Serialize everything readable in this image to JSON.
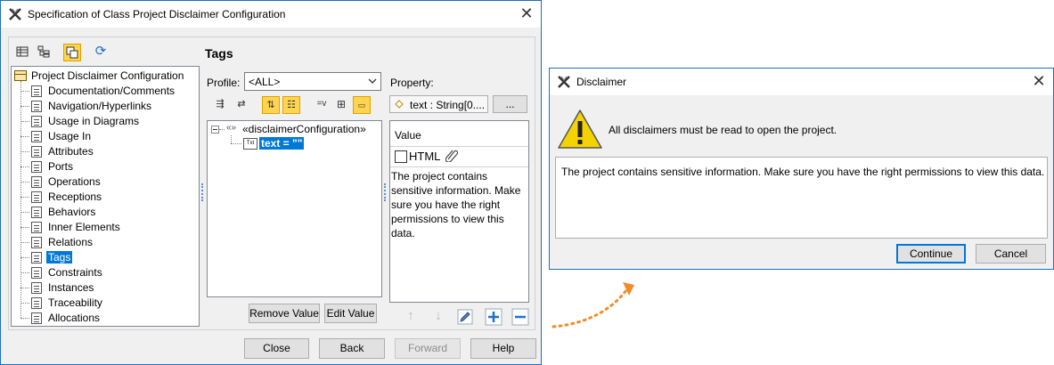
{
  "spec": {
    "title": "Specification of Class Project Disclaimer Configuration",
    "tree": {
      "root": "Project Disclaimer Configuration",
      "items": [
        "Documentation/Comments",
        "Navigation/Hyperlinks",
        "Usage in Diagrams",
        "Usage In",
        "Attributes",
        "Ports",
        "Operations",
        "Receptions",
        "Behaviors",
        "Inner Elements",
        "Relations",
        "Tags",
        "Constraints",
        "Instances",
        "Traceability",
        "Allocations"
      ],
      "selected_index": 11
    },
    "panel_title": "Tags",
    "profile_label": "Profile:",
    "profile_value": "<ALL>",
    "property_label": "Property:",
    "property_value": "text : String[0....",
    "property_button": "...",
    "tag_tree": {
      "stereotype": "«disclaimerConfiguration»",
      "stereotype_prefix": "«»",
      "tag_value": "text = \"\"",
      "text_icon": "Txt"
    },
    "value_header": "Value",
    "html_label": "HTML",
    "value_text": "The project contains sensitive information. Make sure you have the right permissions to view this data.",
    "remove_value": "Remove Value",
    "edit_value": "Edit Value",
    "toolbar_extra": "=v",
    "buttons": {
      "close": "Close",
      "back": "Back",
      "forward": "Forward",
      "help": "Help"
    }
  },
  "disclaimer": {
    "title": "Disclaimer",
    "message": "All disclaimers must be read to open the project.",
    "content": "The project contains sensitive information. Make sure you have the right permissions to view this data.",
    "continue": "Continue",
    "cancel": "Cancel"
  },
  "colors": {
    "accent": "#0078d7",
    "window_border": "#1c6fc2",
    "arrow": "#f28c28",
    "warning": "#f5d300"
  },
  "icons": [
    "app-logo-icon",
    "close-icon",
    "warning-icon",
    "pencil-icon",
    "plus-icon",
    "minus-icon",
    "arrow-up-icon",
    "arrow-down-icon",
    "refresh-icon",
    "chevron-down-icon"
  ]
}
